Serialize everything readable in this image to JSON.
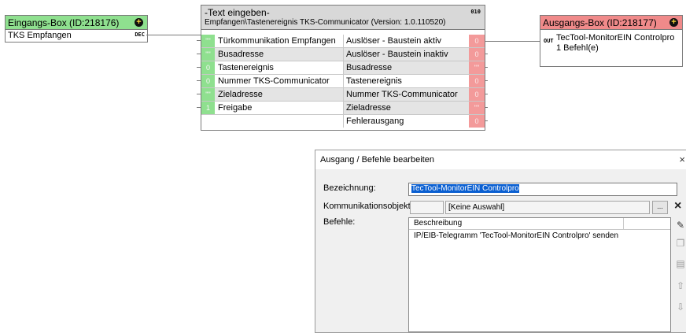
{
  "input_box": {
    "title": "Eingangs-Box (ID:218176)",
    "row_label": "TKS Empfangen",
    "port": "DEC"
  },
  "logic": {
    "title": "-Text eingeben-",
    "subtitle": "Empfangen\\Tastenereignis TKS-Communicator (Version: 1.0.110520)",
    "io_tag": "010",
    "rows": [
      {
        "in_val": "\"\"",
        "in_label": "Türkommunikation Empfangen",
        "out_label": "Auslöser - Baustein aktiv",
        "out_val": "0"
      },
      {
        "in_val": "\"\"",
        "in_label": "Busadresse",
        "out_label": "Auslöser - Baustein inaktiv",
        "out_val": "0"
      },
      {
        "in_val": "0",
        "in_label": "Tastenereignis",
        "out_label": "Busadresse",
        "out_val": "\"\""
      },
      {
        "in_val": "0",
        "in_label": "Nummer TKS-Communicator",
        "out_label": "Tastenereignis",
        "out_val": "0"
      },
      {
        "in_val": "\"\"",
        "in_label": "Zieladresse",
        "out_label": "Nummer TKS-Communicator",
        "out_val": "0"
      },
      {
        "in_val": "1",
        "in_label": "Freigabe",
        "out_label": "Zieladresse",
        "out_val": "\"\""
      },
      {
        "in_val": "",
        "in_label": "",
        "out_label": "Fehlerausgang",
        "out_val": "0"
      }
    ]
  },
  "output_box": {
    "title": "Ausgangs-Box (ID:218177)",
    "port": "OUT",
    "line1": "TecTool-MonitorEIN Controlpro",
    "line2": "1 Befehl(e)"
  },
  "dialog": {
    "title": "Ausgang / Befehle bearbeiten",
    "close": "×",
    "bezeichnung_label": "Bezeichnung:",
    "bezeichnung_value": "TecTool-MonitorEIN Controlpro",
    "komm_label": "Kommunikationsobjekt:",
    "komm_value": "[Keine Auswahl]",
    "browse": "...",
    "clear": "×",
    "befehle_label": "Befehle:",
    "column": "Beschreibung",
    "entries": [
      "IP/EIB-Telegramm 'TecTool-MonitorEIN Controlpro' senden"
    ]
  },
  "colors": {
    "input_header": "#8fe08f",
    "output_header": "#f08a8a",
    "selection": "#0a5fd1"
  }
}
